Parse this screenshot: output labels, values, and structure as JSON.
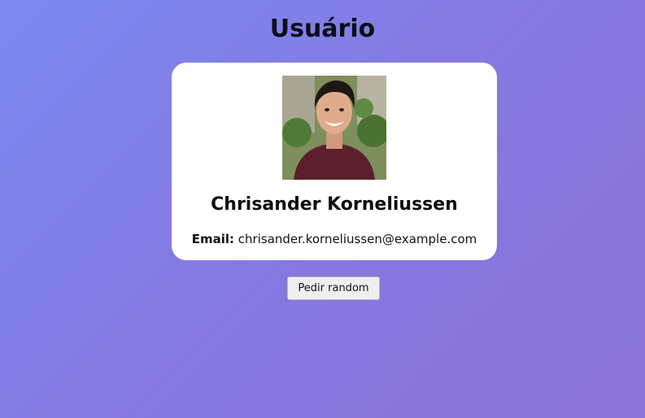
{
  "page": {
    "title": "Usuário"
  },
  "user": {
    "name": "Chrisander Korneliussen",
    "email_label": "Email:",
    "email": "chrisander.korneliussen@example.com",
    "photo_icon": "user-photo"
  },
  "actions": {
    "random_label": "Pedir random"
  },
  "colors": {
    "background_start": "#7b89f0",
    "background_end": "#8a72d8",
    "card": "#ffffff",
    "button": "#efefef"
  }
}
